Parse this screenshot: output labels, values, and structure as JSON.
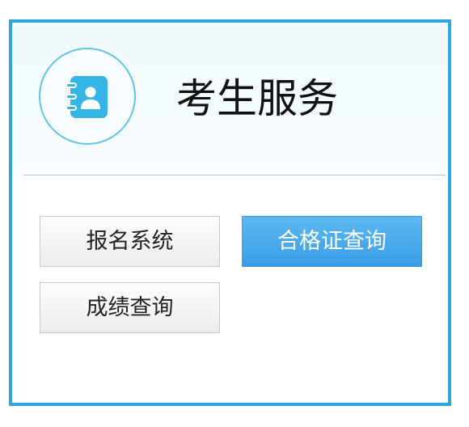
{
  "header": {
    "title": "考生服务",
    "icon": "contact-book-icon",
    "accent_color": "#2ea7e0"
  },
  "buttons": [
    {
      "label": "报名系统",
      "style": "gray"
    },
    {
      "label": "合格证查询",
      "style": "blue"
    },
    {
      "label": "成绩查询",
      "style": "gray"
    }
  ],
  "colors": {
    "border": "#2ea7e0",
    "icon": "#35b4e6",
    "primary_button": "#45a9ea"
  }
}
